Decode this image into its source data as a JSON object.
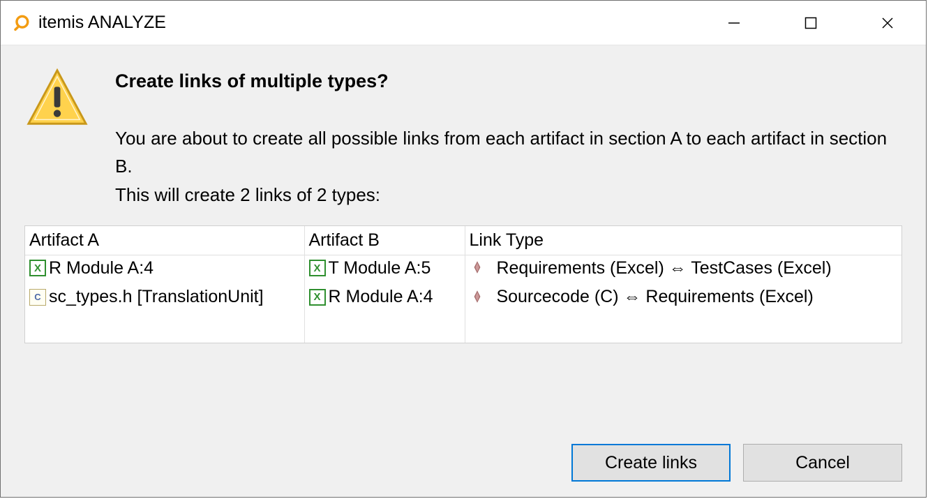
{
  "window": {
    "title": "itemis ANALYZE"
  },
  "dialog": {
    "heading": "Create links of multiple types?",
    "body_line1": "You are about to create all possible links from each artifact in section A to each artifact in section B.",
    "body_line2": "This will create 2 links of 2 types:"
  },
  "table": {
    "headers": {
      "colA": "Artifact A",
      "colB": "Artifact B",
      "colLink": "Link Type"
    },
    "rows": [
      {
        "a_icon": "excel",
        "a_label": "R Module A:4",
        "b_icon": "excel",
        "b_label": "T Module A:5",
        "link_label": "Requirements (Excel) ⇔ TestCases (Excel)"
      },
      {
        "a_icon": "cfile",
        "a_label": "sc_types.h [TranslationUnit]",
        "b_icon": "excel",
        "b_label": "R Module A:4",
        "link_label": "Sourcecode (C) ⇔ Requirements (Excel)"
      }
    ]
  },
  "buttons": {
    "primary": "Create links",
    "cancel": "Cancel"
  }
}
